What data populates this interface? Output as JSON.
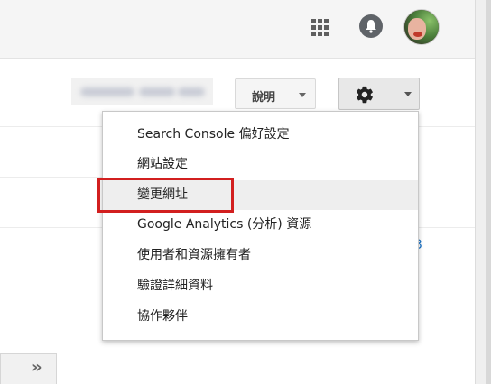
{
  "header": {
    "apps_icon": "apps-grid-icon",
    "notifications_icon": "bell-icon",
    "avatar": "user-avatar"
  },
  "toolbar": {
    "help_label": "說明",
    "help_caret_icon": "chevron-down-icon",
    "settings_icon": "gear-icon",
    "settings_caret_icon": "chevron-down-icon"
  },
  "settings_menu": {
    "items": [
      {
        "label": "Search Console 偏好設定"
      },
      {
        "label": "網站設定"
      },
      {
        "label": "變更網址",
        "highlighted": true
      },
      {
        "label": "Google Analytics (分析) 資源"
      },
      {
        "label": "使用者和資源擁有者"
      },
      {
        "label": "驗證詳細資料"
      },
      {
        "label": "協作夥伴"
      }
    ],
    "highlight_color": "#d21f1f"
  },
  "partial_link_text": "3",
  "expand_button": {
    "label": "»"
  },
  "colors": {
    "link": "#1a73c8",
    "topbar": "#f5f5f5"
  }
}
